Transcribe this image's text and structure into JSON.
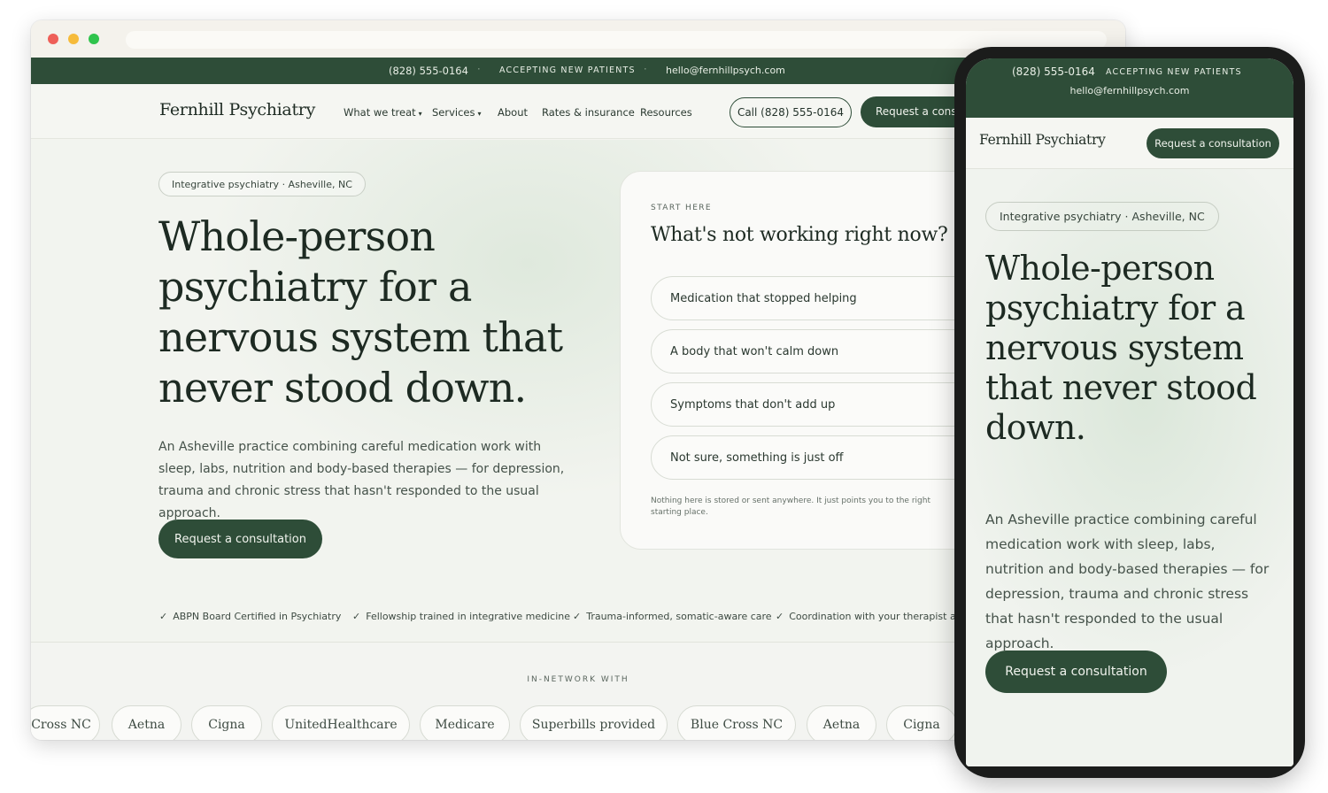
{
  "topbar": {
    "phone": "(828) 555-0164",
    "separator": "·",
    "accepting": "ACCEPTING NEW PATIENTS",
    "email": "hello@fernhillpsych.com"
  },
  "nav": {
    "logo": "Fernhill Psychiatry",
    "links": [
      {
        "label": "What we treat",
        "dropdown": true
      },
      {
        "label": "Services",
        "dropdown": true
      },
      {
        "label": "About",
        "dropdown": false
      },
      {
        "label": "Rates & insurance",
        "dropdown": false
      },
      {
        "label": "Resources",
        "dropdown": false
      }
    ],
    "caret": "▾",
    "call_button": "Call (828) 555-0164",
    "request_button": "Request a consultation"
  },
  "hero": {
    "location_pill": "Integrative psychiatry · Asheville, NC",
    "headline": "Whole-person psychiatry for a nervous system that never stood down.",
    "lede": "An Asheville practice combining careful medication work with sleep, labs, nutrition and body-based therapies — for depression, trauma and chronic stress that hasn't responded to the usual approach.",
    "cta": "Request a consultation"
  },
  "card": {
    "eyebrow": "START HERE",
    "title": "What's not working right now?",
    "options": [
      "Medication that stopped helping",
      "A body that won't calm down",
      "Symptoms that don't add up",
      "Not sure, something is just off"
    ],
    "note": "Nothing here is stored or sent anywhere. It just points you to the right starting place."
  },
  "trust": {
    "check": "✓",
    "items": [
      "ABPN Board Certified in Psychiatry",
      "Fellowship trained in integrative medicine",
      "Trauma-informed, somatic-aware care",
      "Coordination with your therapist and"
    ]
  },
  "in_network": {
    "label": "IN-NETWORK WITH",
    "chips": [
      "Cross NC",
      "Aetna",
      "Cigna",
      "UnitedHealthcare",
      "Medicare",
      "Superbills provided",
      "Blue Cross NC",
      "Aetna",
      "Cigna"
    ]
  },
  "mobile": {
    "phone": "(828) 555-0164",
    "accepting": "ACCEPTING NEW PATIENTS",
    "email": "hello@fernhillpsych.com",
    "logo": "Fernhill Psychiatry",
    "request_button": "Request a consultation",
    "location_pill": "Integrative psychiatry · Asheville, NC",
    "headline": "Whole-person psychiatry for a nervous system that never stood down.",
    "lede": "An Asheville practice combining careful medication work with sleep, labs, nutrition and body-based therapies — for depression, trauma and chronic stress that hasn't responded to the usual approach.",
    "cta": "Request a consultation"
  },
  "colors": {
    "brand_green": "#2e4d38",
    "page_bg": "#f2f4ef",
    "text_dark": "#1d2a22"
  }
}
